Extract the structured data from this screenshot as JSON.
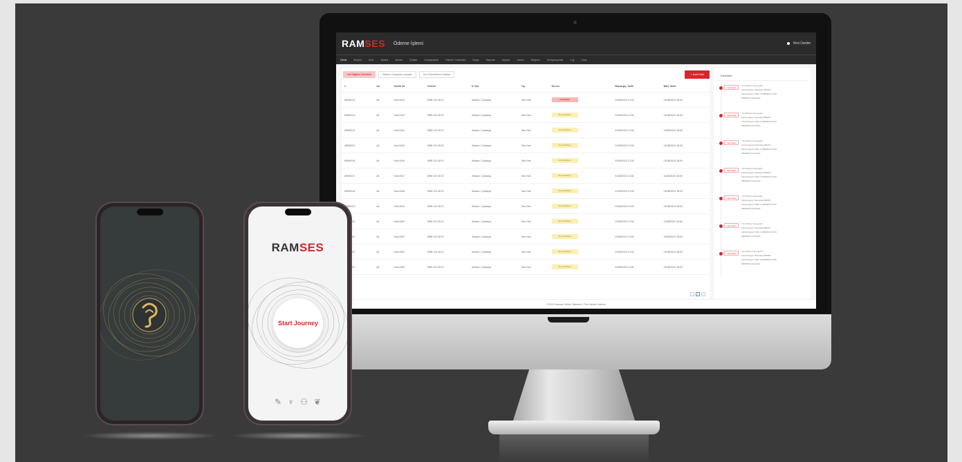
{
  "brand": {
    "name_part1": "RAM",
    "name_part2": "SES",
    "accent": "#d8252b"
  },
  "desktop": {
    "title": "Ödeme İşlemi",
    "user": "Yeni Üretim",
    "nav": [
      "Genel",
      "Müşteri",
      "Ürün",
      "Sipariş",
      "Stoklar",
      "Fiyatlar",
      "Kampanyalar",
      "Ödeme Yöntemleri",
      "Kargo",
      "Raporlar",
      "Ayarlar",
      "Yardım",
      "Belgeler",
      "Entegrasyonlar",
      "Log",
      "Çıkış"
    ],
    "filters": [
      "Kart Bilgileri Görüntüle",
      "Sadece Onaylanan Kayıtlar",
      "Son Güncellenen Kayıtlar"
    ],
    "add_button": "+ Kart Ekle",
    "columns": [
      "#",
      "Ad",
      "Kimlik No",
      "Telefon",
      "İl / İlçe",
      "Tip",
      "Durum",
      "Başlangıç Tarihi",
      "Bitiş Tarihi"
    ],
    "rows": [
      {
        "id": "#RM0012",
        "name": "Ali",
        "kimlik": "Kart-0042",
        "phone": "0555 123 45 67",
        "loc": "Ankara / Çankaya",
        "type": "Tam Kart",
        "status": "Reddedildi",
        "start": "01/08/2023 13:30",
        "end": "01/08/2023 18:00",
        "red": true
      },
      {
        "id": "#RM0013",
        "name": "Ali",
        "kimlik": "Kart-0043",
        "phone": "0555 123 45 67",
        "loc": "Ankara / Çankaya",
        "type": "Tam Kart",
        "status": "Onay Bekliyor",
        "start": "01/08/2023 13:30",
        "end": "01/08/2023 18:00"
      },
      {
        "id": "#RM0014",
        "name": "Ali",
        "kimlik": "Kart-0044",
        "phone": "0555 123 45 67",
        "loc": "Ankara / Çankaya",
        "type": "Tam Kart",
        "status": "Onay Bekliyor",
        "start": "01/08/2023 13:30",
        "end": "01/08/2023 18:00"
      },
      {
        "id": "#RM0015",
        "name": "Ali",
        "kimlik": "Kart-0045",
        "phone": "0555 123 45 67",
        "loc": "Ankara / Çankaya",
        "type": "Tam Kart",
        "status": "Onay Bekliyor",
        "start": "01/08/2023 13:30",
        "end": "01/08/2023 18:00"
      },
      {
        "id": "#RM0016",
        "name": "Ali",
        "kimlik": "Kart-0046",
        "phone": "0555 123 45 67",
        "loc": "Ankara / Çankaya",
        "type": "Tam Kart",
        "status": "Onay Bekliyor",
        "start": "01/08/2023 13:30",
        "end": "01/08/2023 18:00"
      },
      {
        "id": "#RM0017",
        "name": "Ali",
        "kimlik": "Kart-0047",
        "phone": "0555 123 45 67",
        "loc": "Ankara / Çankaya",
        "type": "Tam Kart",
        "status": "Onay Bekliyor",
        "start": "01/08/2023 13:30",
        "end": "01/08/2023 18:00"
      },
      {
        "id": "#RM0018",
        "name": "Ali",
        "kimlik": "Kart-0048",
        "phone": "0555 123 45 67",
        "loc": "Ankara / Çankaya",
        "type": "Tam Kart",
        "status": "Onay Bekliyor",
        "start": "01/08/2023 13:30",
        "end": "01/08/2023 18:00"
      },
      {
        "id": "#RM0019",
        "name": "Ali",
        "kimlik": "Kart-0049",
        "phone": "0555 123 45 67",
        "loc": "Ankara / Çankaya",
        "type": "Tam Kart",
        "status": "Onay Bekliyor",
        "start": "01/08/2023 13:30",
        "end": "01/08/2023 18:00"
      },
      {
        "id": "#RM0020",
        "name": "Ali",
        "kimlik": "Kart-0050",
        "phone": "0555 123 45 67",
        "loc": "Ankara / Çankaya",
        "type": "Tam Kart",
        "status": "Onay Bekliyor",
        "start": "01/08/2023 13:30",
        "end": "01/08/2023 18:00"
      },
      {
        "id": "#RM0021",
        "name": "Ali",
        "kimlik": "Kart-0051",
        "phone": "0555 123 45 67",
        "loc": "Ankara / Çankaya",
        "type": "Tam Kart",
        "status": "Onay Bekliyor",
        "start": "01/08/2023 13:30",
        "end": "01/08/2023 18:00"
      },
      {
        "id": "#RM0022",
        "name": "Ali",
        "kimlik": "Kart-0052",
        "phone": "0555 123 45 67",
        "loc": "Ankara / Çankaya",
        "type": "Tam Kart",
        "status": "Onay Bekliyor",
        "start": "01/08/2023 13:30",
        "end": "01/08/2023 18:00"
      },
      {
        "id": "#RM0023",
        "name": "Ali",
        "kimlik": "Kart-0053",
        "phone": "0555 123 45 67",
        "loc": "Ankara / Çankaya",
        "type": "Tam Kart",
        "status": "Onay Bekliyor",
        "start": "01/08/2023 13:30",
        "end": "01/08/2023 18:00"
      }
    ],
    "timeline_title": "Etkinlikler",
    "timeline": [
      {
        "tag": "Yeni Kayıt",
        "lines": [
          "Tur #15 git 1 kuş geçiti",
          "Rezervasyon Numarası #RM12",
          "Rezervasyon Tarihi: 01/08/2023 13:30",
          "#RM0015 Görüntüle"
        ]
      },
      {
        "tag": "Yeni Kayıt",
        "lines": [
          "Tur #15 git 1 kuş geçiti",
          "Rezervasyon Numarası #RM13",
          "Rezervasyon Tarihi: 01/08/2023 13:30",
          "#RM0016 Görüntüle"
        ]
      },
      {
        "tag": "Yeni Kayıt",
        "lines": [
          "Tur #15 git 1 kuş geçiti",
          "Rezervasyon Numarası #RM14",
          "Rezervasyon Tarihi: 01/08/2023 13:30",
          "#RM0017 Görüntüle"
        ]
      },
      {
        "tag": "Yeni Kayıt",
        "lines": [
          "Tur #15 git 1 kuş geçiti",
          "Rezervasyon Numarası #RM15",
          "Rezervasyon Tarihi: 01/08/2023 13:30",
          "#RM0018 Görüntüle"
        ]
      },
      {
        "tag": "Yeni Kayıt",
        "lines": [
          "Tur #15 git 1 kuş geçiti",
          "Rezervasyon Numarası #RM16",
          "Rezervasyon Tarihi: 01/08/2023 13:30",
          "#RM0019 Görüntüle"
        ]
      },
      {
        "tag": "Yeni Kayıt",
        "lines": [
          "Tur #15 git 1 kuş geçiti",
          "Rezervasyon Numarası #RM17",
          "Rezervasyon Tarihi: 01/08/2023 13:30",
          "#RM0020 Görüntüle"
        ]
      },
      {
        "tag": "Yeni Kayıt",
        "lines": [
          "Tur #15 git 1 kuş geçiti",
          "Rezervasyon Numarası #RM18",
          "Rezervasyon Tarihi: 01/08/2023 13:30",
          "#RM0021 Görüntüle"
        ]
      }
    ],
    "pagination": [
      "‹",
      "1",
      "›"
    ],
    "footer": "©2023 Ramses Online Sistemler | Tüm Hakları Saklıdır"
  },
  "phone_right": {
    "start_button": "Start Journey",
    "icons": [
      "wand-icon",
      "trophy-icon",
      "people-icon",
      "leaf-icon"
    ]
  },
  "phone_left": {
    "emblem": "gold-ear-emblem-icon"
  }
}
